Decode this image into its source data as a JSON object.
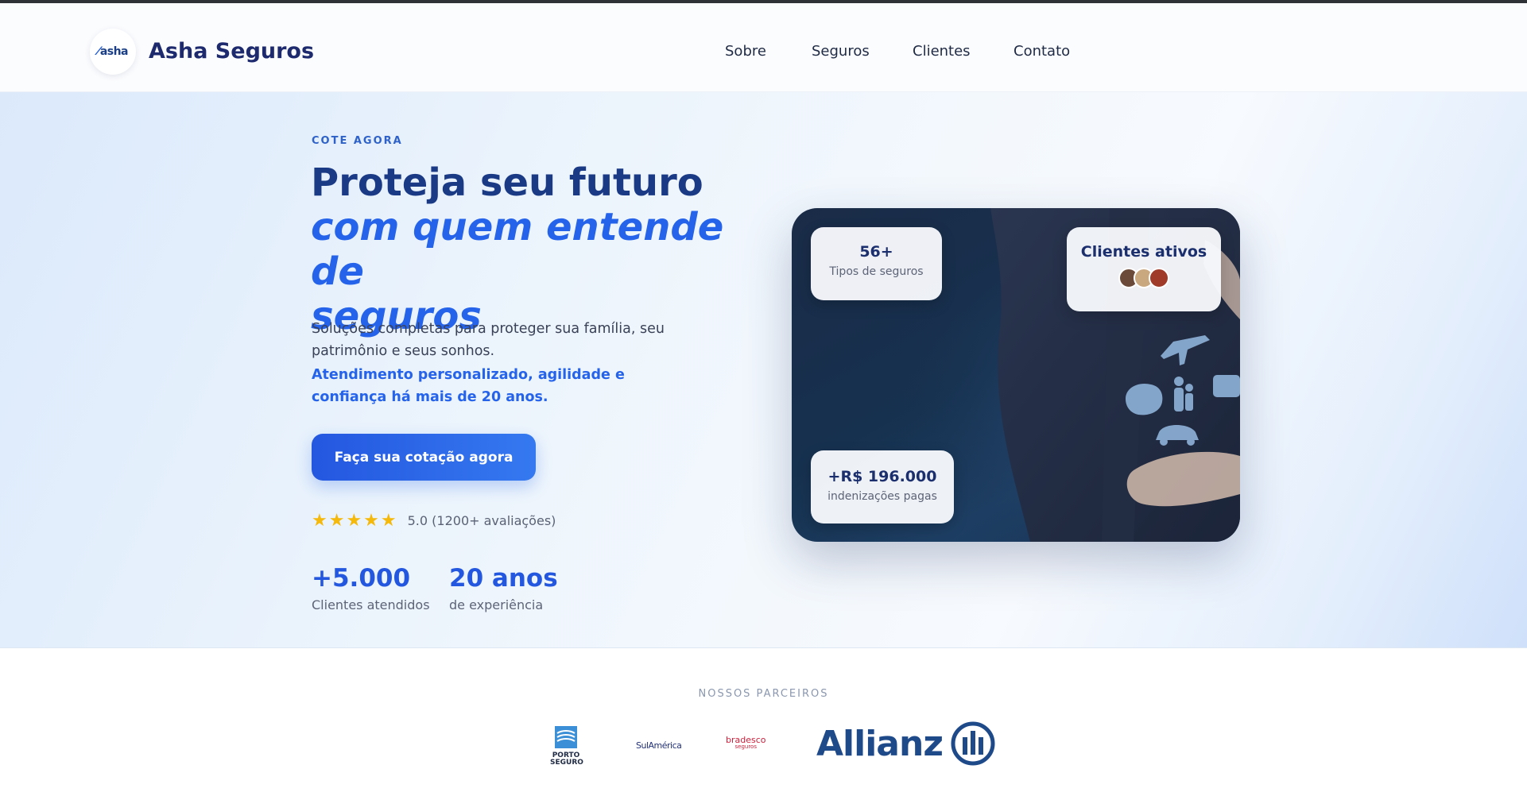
{
  "header": {
    "logo_text": "asha",
    "brand": "Asha Seguros",
    "nav": [
      {
        "label": "Sobre"
      },
      {
        "label": "Seguros"
      },
      {
        "label": "Clientes"
      },
      {
        "label": "Contato"
      }
    ]
  },
  "hero": {
    "eyebrow": "COTE AGORA",
    "title_line1": "Proteja seu futuro",
    "title_line2": "com quem entende de",
    "title_line3": "seguros",
    "description": "Soluções completas para proteger sua família, seu patrimônio e seus sonhos.",
    "description_strong": "Atendimento personalizado, agilidade e confiança há mais de 20 anos.",
    "cta_label": "Faça sua cotação agora",
    "stars": "★★★★★",
    "rating_text": "5.0 (1200+ avaliações)",
    "stats": [
      {
        "value": "+5.000",
        "label": "Clientes atendidos"
      },
      {
        "value": "20 anos",
        "label": "de experiência"
      }
    ]
  },
  "card": {
    "types_value": "56+",
    "types_label": "Tipos de seguros",
    "clients_label": "Clientes ativos",
    "indemnity_value": "+R$ 196.000",
    "indemnity_label": "indenizações pagas"
  },
  "partners": {
    "title": "NOSSOS PARCEIROS",
    "porto_line1": "PORTO",
    "porto_line2": "SEGURO",
    "sulamerica": "SulAmérica",
    "bradesco": "bradesco",
    "bradesco_sub": "seguros",
    "allianz": "Allianz"
  },
  "colors": {
    "primary": "#2563eb",
    "navy": "#1b3a86",
    "star": "#f5b90b"
  }
}
